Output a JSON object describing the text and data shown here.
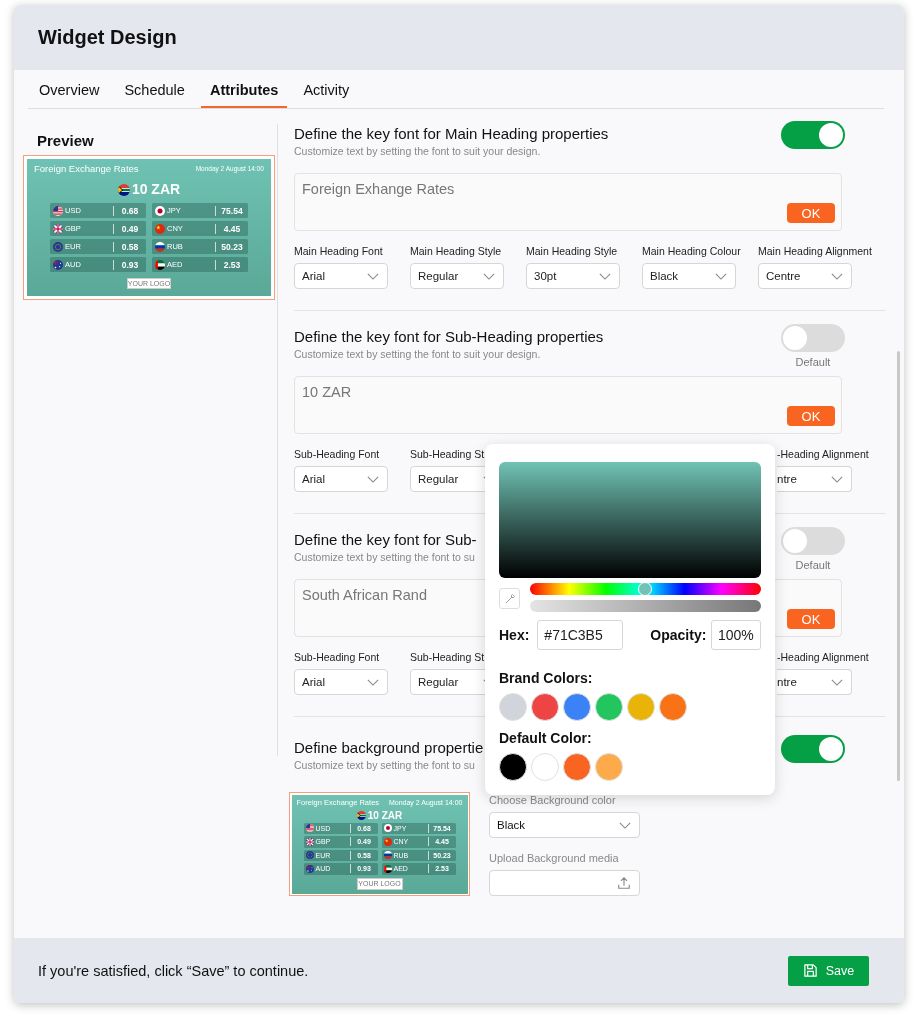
{
  "header": {
    "title": "Widget Design"
  },
  "tabs": [
    {
      "label": "Overview",
      "selected": false
    },
    {
      "label": "Schedule",
      "selected": false
    },
    {
      "label": "Attributes",
      "selected": true
    },
    {
      "label": "Activity",
      "selected": false
    }
  ],
  "preview": {
    "label": "Preview",
    "widget": {
      "title": "Foreign Exchange Rates",
      "date": "Monday 2 August 14:00",
      "amount": "10 ZAR",
      "amount_flag": {
        "kind": "za"
      },
      "logo": "YOUR LOGO",
      "rates": [
        {
          "code": "USD",
          "value": "0.68",
          "kind": "us"
        },
        {
          "code": "JPY",
          "value": "75.54",
          "kind": "jp"
        },
        {
          "code": "GBP",
          "value": "0.49",
          "kind": "gb"
        },
        {
          "code": "CNY",
          "value": "4.45",
          "kind": "cn"
        },
        {
          "code": "EUR",
          "value": "0.58",
          "kind": "eu"
        },
        {
          "code": "RUB",
          "value": "50.23",
          "kind": "ru"
        },
        {
          "code": "AUD",
          "value": "0.93",
          "kind": "au"
        },
        {
          "code": "AED",
          "value": "2.53",
          "kind": "ae"
        }
      ]
    }
  },
  "sections": [
    {
      "title": "Define the key font for Main Heading properties",
      "subtitle": "Customize text by setting the font to suit your design.",
      "toggle": {
        "on": true
      },
      "text_box": {
        "value": "Foreign Exhange Rates",
        "button": "OK"
      },
      "fields": [
        {
          "kind": "full",
          "label": "Main Heading Font",
          "value": "Arial"
        },
        {
          "kind": "full",
          "label": "Main Heading Style",
          "value": "Regular"
        },
        {
          "kind": "full",
          "label": "Main Heading Style",
          "value": "30pt"
        },
        {
          "kind": "full",
          "label": "Main Heading Colour",
          "value": "Black"
        },
        {
          "kind": "full",
          "label": "Main Heading Alignment",
          "value": "Centre"
        }
      ]
    },
    {
      "title": "Define the key font for Sub-Heading properties",
      "subtitle": "Customize text by setting the font to suit your design.",
      "toggle": {
        "on": false,
        "caption": "Default"
      },
      "text_box": {
        "value": "10 ZAR",
        "button": "OK"
      },
      "fields": [
        {
          "kind": "full",
          "label": "Sub-Heading Font",
          "value": "Arial"
        },
        {
          "kind": "clipped_right",
          "label": "Sub-Heading St",
          "value": "Regular"
        },
        {
          "kind": "clipped_left",
          "label": "-Heading Alignment",
          "value": "ntre"
        }
      ]
    },
    {
      "title": "Define the key font for Sub-",
      "subtitle": "Customize text by setting the font to su",
      "toggle": {
        "on": false,
        "caption": "Default"
      },
      "text_box": {
        "value": "South African Rand",
        "button": "OK"
      },
      "fields": [
        {
          "kind": "full",
          "label": "Sub-Heading Font",
          "value": "Arial"
        },
        {
          "kind": "clipped_right",
          "label": "Sub-Heading St",
          "value": "Regular"
        },
        {
          "kind": "clipped_left",
          "label": "-Heading Alignment",
          "value": "ntre"
        }
      ]
    }
  ],
  "background": {
    "title": "Define background propertie",
    "subtitle": "Customize text by setting the font to su",
    "toggle": {
      "on": true
    },
    "widget": {
      "title": "Foreign Exchange Rates",
      "date": "Monday 2 August 14:00",
      "amount": "10 ZAR",
      "amount_flag": {
        "kind": "za"
      },
      "logo": "YOUR LOGO",
      "rates": [
        {
          "code": "USD",
          "value": "0.68",
          "kind": "us"
        },
        {
          "code": "JPY",
          "value": "75.54",
          "kind": "jp"
        },
        {
          "code": "GBP",
          "value": "0.49",
          "kind": "gb"
        },
        {
          "code": "CNY",
          "value": "4.45",
          "kind": "cn"
        },
        {
          "code": "EUR",
          "value": "0.58",
          "kind": "eu"
        },
        {
          "code": "RUB",
          "value": "50.23",
          "kind": "ru"
        },
        {
          "code": "AUD",
          "value": "0.93",
          "kind": "au"
        },
        {
          "code": "AED",
          "value": "2.53",
          "kind": "ae"
        }
      ]
    },
    "color_field": {
      "label": "Choose Background color",
      "value": "Black"
    },
    "upload_field": {
      "label": "Upload Background media"
    }
  },
  "color_picker": {
    "hue": {
      "level": 0.5
    },
    "hex_label": "Hex:",
    "hex": "#71C3B5",
    "opacity_label": "Opacity:",
    "opacity": "100%",
    "brand_label": "Brand Colors:",
    "brand_colors": [
      {
        "color": "#d1d5db"
      },
      {
        "color": "#ef4444"
      },
      {
        "color": "#3b82f6"
      },
      {
        "color": "#22c55e"
      },
      {
        "color": "#eab308"
      },
      {
        "color": "#f97316"
      }
    ],
    "default_label": "Default Color:",
    "default_colors": [
      {
        "color": "#000000"
      },
      {
        "color": "#ffffff"
      },
      {
        "color": "#f96520"
      },
      {
        "color": "#fdab4a"
      }
    ]
  },
  "footer": {
    "message": "If you're satisfied, click “Save” to continue.",
    "save_button": "Save"
  }
}
